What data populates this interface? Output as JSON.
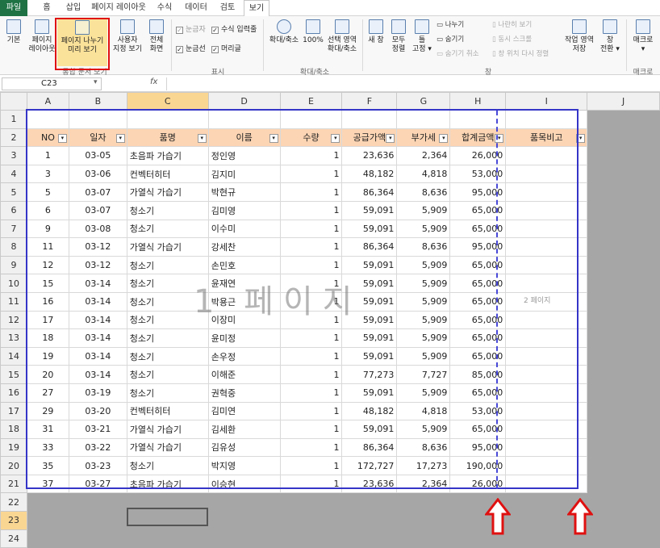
{
  "menu": {
    "tabs": [
      "파일",
      "홈",
      "삽입",
      "페이지 레이아웃",
      "수식",
      "데이터",
      "검토",
      "보기"
    ]
  },
  "ribbon": {
    "workbook_views": {
      "normal": "기본",
      "page_layout_1": "페이지",
      "page_layout_2": "레이아웃",
      "page_break_1": "페이지 나누기",
      "page_break_2": "미리 보기",
      "custom_1": "사용자",
      "custom_2": "지정 보기",
      "full_1": "전체",
      "full_2": "화면",
      "label": "통합 문서 보기"
    },
    "show": {
      "ruler": "눈금자",
      "formula_bar": "수식 입력줄",
      "gridlines": "눈금선",
      "headings": "머리글",
      "label": "표시"
    },
    "zoom": {
      "zoom": "확대/축소",
      "pct": "100%",
      "sel_1": "선택 영역",
      "sel_2": "확대/축소",
      "label": "확대/축소"
    },
    "window": {
      "new_window": "새 창",
      "arrange_1": "모두",
      "arrange_2": "정렬",
      "freeze_1": "틀",
      "freeze_2": "고정 ▾",
      "split": "나누기",
      "hide": "숨기기",
      "unhide": "숨기기 취소",
      "side_by_side": "나란히 보기",
      "sync_scroll": "동시 스크롤",
      "reset_pos": "창 위치 다시 정렬",
      "save_ws_1": "작업 영역",
      "save_ws_2": "저장",
      "switch_1": "창",
      "switch_2": "전환 ▾",
      "label": "창"
    },
    "macros": {
      "macro_1": "매크로",
      "macro_2": "▾",
      "label": "매크로"
    }
  },
  "formula_bar": {
    "cell": "C23",
    "fx": "fx",
    "value": ""
  },
  "columns": [
    "A",
    "B",
    "C",
    "D",
    "E",
    "F",
    "G",
    "H",
    "I",
    "J"
  ],
  "headers": [
    "NO",
    "일자",
    "품명",
    "이름",
    "수량",
    "공급가액",
    "부가세",
    "합계금액",
    "품목비고"
  ],
  "rows": [
    [
      "1",
      "03-05",
      "초음파 가습기",
      "정인영",
      "1",
      "23,636",
      "2,364",
      "26,000"
    ],
    [
      "3",
      "03-06",
      "컨벡터히터",
      "김지미",
      "1",
      "48,182",
      "4,818",
      "53,000"
    ],
    [
      "5",
      "03-07",
      "가열식 가습기",
      "박현규",
      "1",
      "86,364",
      "8,636",
      "95,000"
    ],
    [
      "6",
      "03-07",
      "청소기",
      "김미영",
      "1",
      "59,091",
      "5,909",
      "65,000"
    ],
    [
      "9",
      "03-08",
      "청소기",
      "이수미",
      "1",
      "59,091",
      "5,909",
      "65,000"
    ],
    [
      "11",
      "03-12",
      "가열식 가습기",
      "강세찬",
      "1",
      "86,364",
      "8,636",
      "95,000"
    ],
    [
      "12",
      "03-12",
      "청소기",
      "손민호",
      "1",
      "59,091",
      "5,909",
      "65,000"
    ],
    [
      "15",
      "03-14",
      "청소기",
      "윤재연",
      "1",
      "59,091",
      "5,909",
      "65,000"
    ],
    [
      "16",
      "03-14",
      "청소기",
      "박용근",
      "1",
      "59,091",
      "5,909",
      "65,000"
    ],
    [
      "17",
      "03-14",
      "청소기",
      "이장미",
      "1",
      "59,091",
      "5,909",
      "65,000"
    ],
    [
      "18",
      "03-14",
      "청소기",
      "윤미정",
      "1",
      "59,091",
      "5,909",
      "65,000"
    ],
    [
      "19",
      "03-14",
      "청소기",
      "손우정",
      "1",
      "59,091",
      "5,909",
      "65,000"
    ],
    [
      "20",
      "03-14",
      "청소기",
      "이해준",
      "1",
      "77,273",
      "7,727",
      "85,000"
    ],
    [
      "27",
      "03-19",
      "청소기",
      "권혁중",
      "1",
      "59,091",
      "5,909",
      "65,000"
    ],
    [
      "29",
      "03-20",
      "컨벡터히터",
      "김미연",
      "1",
      "48,182",
      "4,818",
      "53,000"
    ],
    [
      "31",
      "03-21",
      "가열식 가습기",
      "김세환",
      "1",
      "59,091",
      "5,909",
      "65,000"
    ],
    [
      "33",
      "03-22",
      "가열식 가습기",
      "김유성",
      "1",
      "86,364",
      "8,636",
      "95,000"
    ],
    [
      "35",
      "03-23",
      "청소기",
      "박지영",
      "1",
      "172,727",
      "17,273",
      "190,000"
    ],
    [
      "37",
      "03-27",
      "초음파 가습기",
      "이승현",
      "1",
      "23,636",
      "2,364",
      "26,000"
    ]
  ],
  "watermark": {
    "page1": "1 페이지",
    "page2": "2 페이지"
  },
  "colors": {
    "excel_green": "#1f7244",
    "header_fill": "#fcd5b4",
    "page_border": "#3535c8",
    "highlight": "#e01010"
  }
}
